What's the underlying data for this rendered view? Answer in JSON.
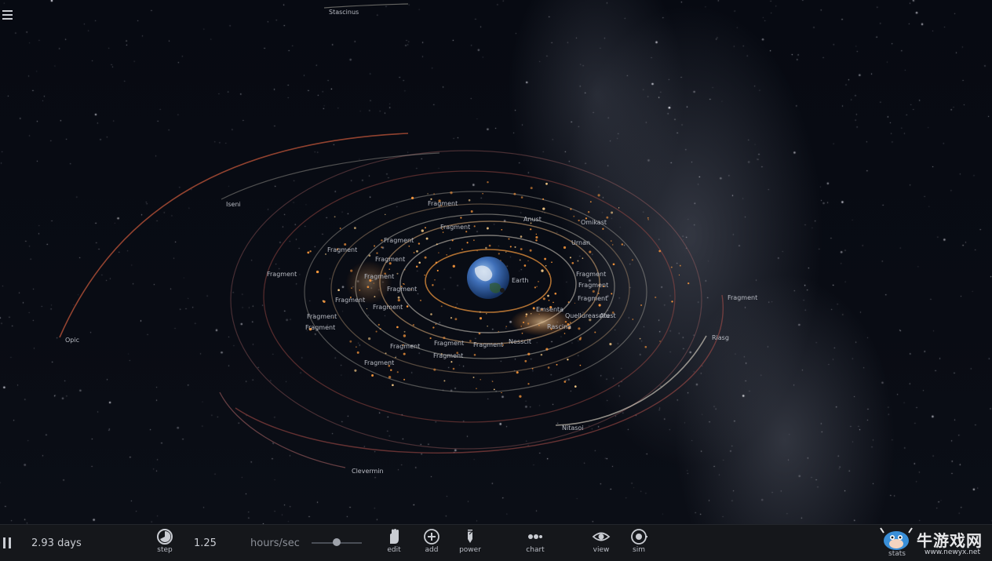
{
  "app": {
    "menu_icon": "hamburger-menu-icon"
  },
  "bodies": {
    "central": "Earth",
    "labels": [
      "Stascinus",
      "Iseni",
      "Opic",
      "Fragment",
      "Fragment",
      "Fragment",
      "Fragment",
      "Fragment",
      "Fragment",
      "Fragment",
      "Fragment",
      "Fragment",
      "Fragment",
      "Fragment",
      "Fragment",
      "Fragment",
      "Fragment",
      "Fragment",
      "Fragment",
      "Fragment",
      "Fragment",
      "Fragment",
      "Anust",
      "Omikast",
      "Urnan",
      "Quellureascilu",
      "Fragment",
      "Riasg",
      "Rascina",
      "Emsenta",
      "Nesscit",
      "Nitasoi",
      "Clevermin",
      "Atest",
      "Fragment"
    ]
  },
  "toolbar": {
    "time_elapsed": "2.93 days",
    "step_label": "step",
    "speed_value": "1.25",
    "speed_unit": "hours/sec",
    "speed_slider_position": 0.5,
    "edit_label": "edit",
    "add_label": "add",
    "power_label": "power",
    "chart_label": "chart",
    "view_label": "view",
    "sim_label": "sim"
  },
  "watermark": {
    "text": "牛游戏网",
    "url": "www.newyx.net",
    "stats_label": "stats"
  },
  "colors": {
    "toolbar_bg": "#15171b",
    "earth_blue": "#3f6fb8",
    "orbit_orange": "#d98a3a",
    "orbit_red": "#b0504a",
    "orbit_white": "#d8d2c4",
    "fragment_glow": "#ff9a3c"
  }
}
